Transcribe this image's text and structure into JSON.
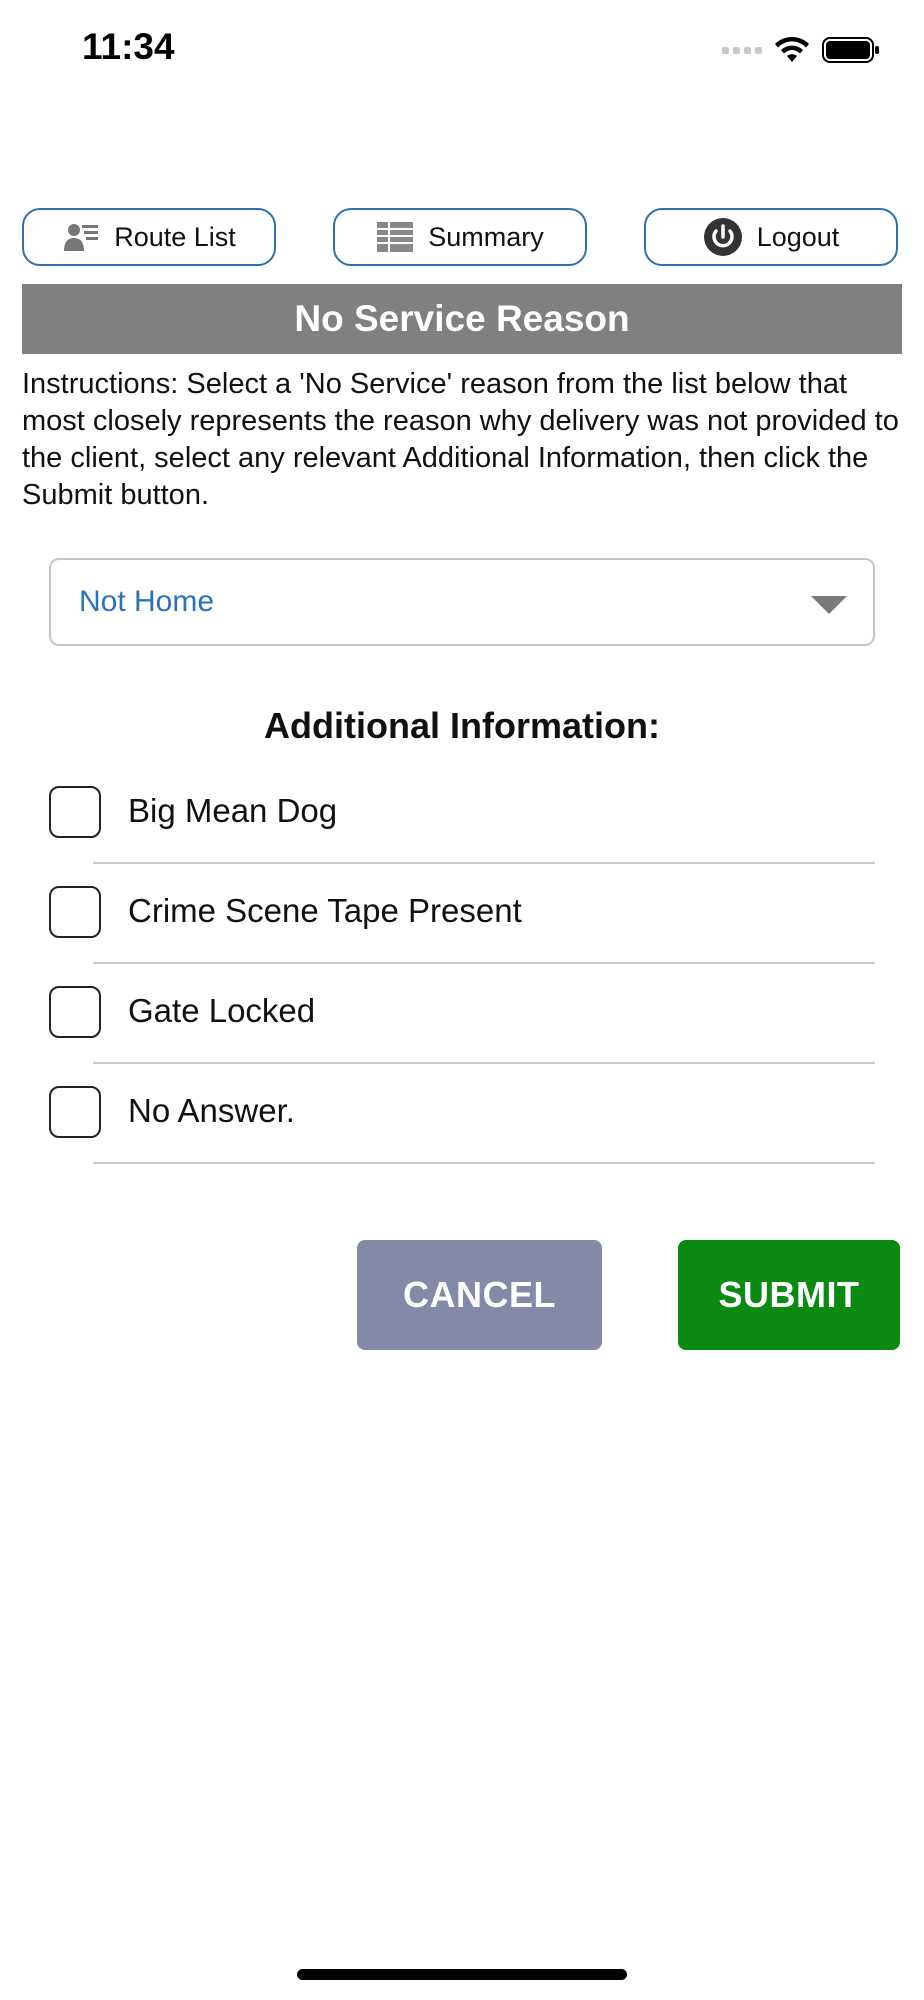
{
  "status_bar": {
    "time": "11:34"
  },
  "nav": {
    "route_list_label": "Route List",
    "summary_label": "Summary",
    "logout_label": "Logout"
  },
  "header": {
    "title": "No Service Reason"
  },
  "instructions": "Instructions: Select a 'No Service' reason from the list below that most closely represents the reason why delivery was not provided to the client, select any relevant Additional Information, then click the Submit button.",
  "reason_select": {
    "selected": "Not Home"
  },
  "additional_info": {
    "title": "Additional Information:",
    "options": [
      {
        "label": "Big Mean Dog",
        "checked": false
      },
      {
        "label": "Crime Scene Tape Present",
        "checked": false
      },
      {
        "label": "Gate Locked",
        "checked": false
      },
      {
        "label": "No Answer.",
        "checked": false
      }
    ]
  },
  "actions": {
    "cancel_label": "CANCEL",
    "submit_label": "SUBMIT"
  },
  "colors": {
    "accent_border": "#2f6fb3",
    "header_bg": "#808080",
    "cancel_bg": "#8389a7",
    "submit_bg": "#0b8a12",
    "select_text": "#2b73b8"
  }
}
